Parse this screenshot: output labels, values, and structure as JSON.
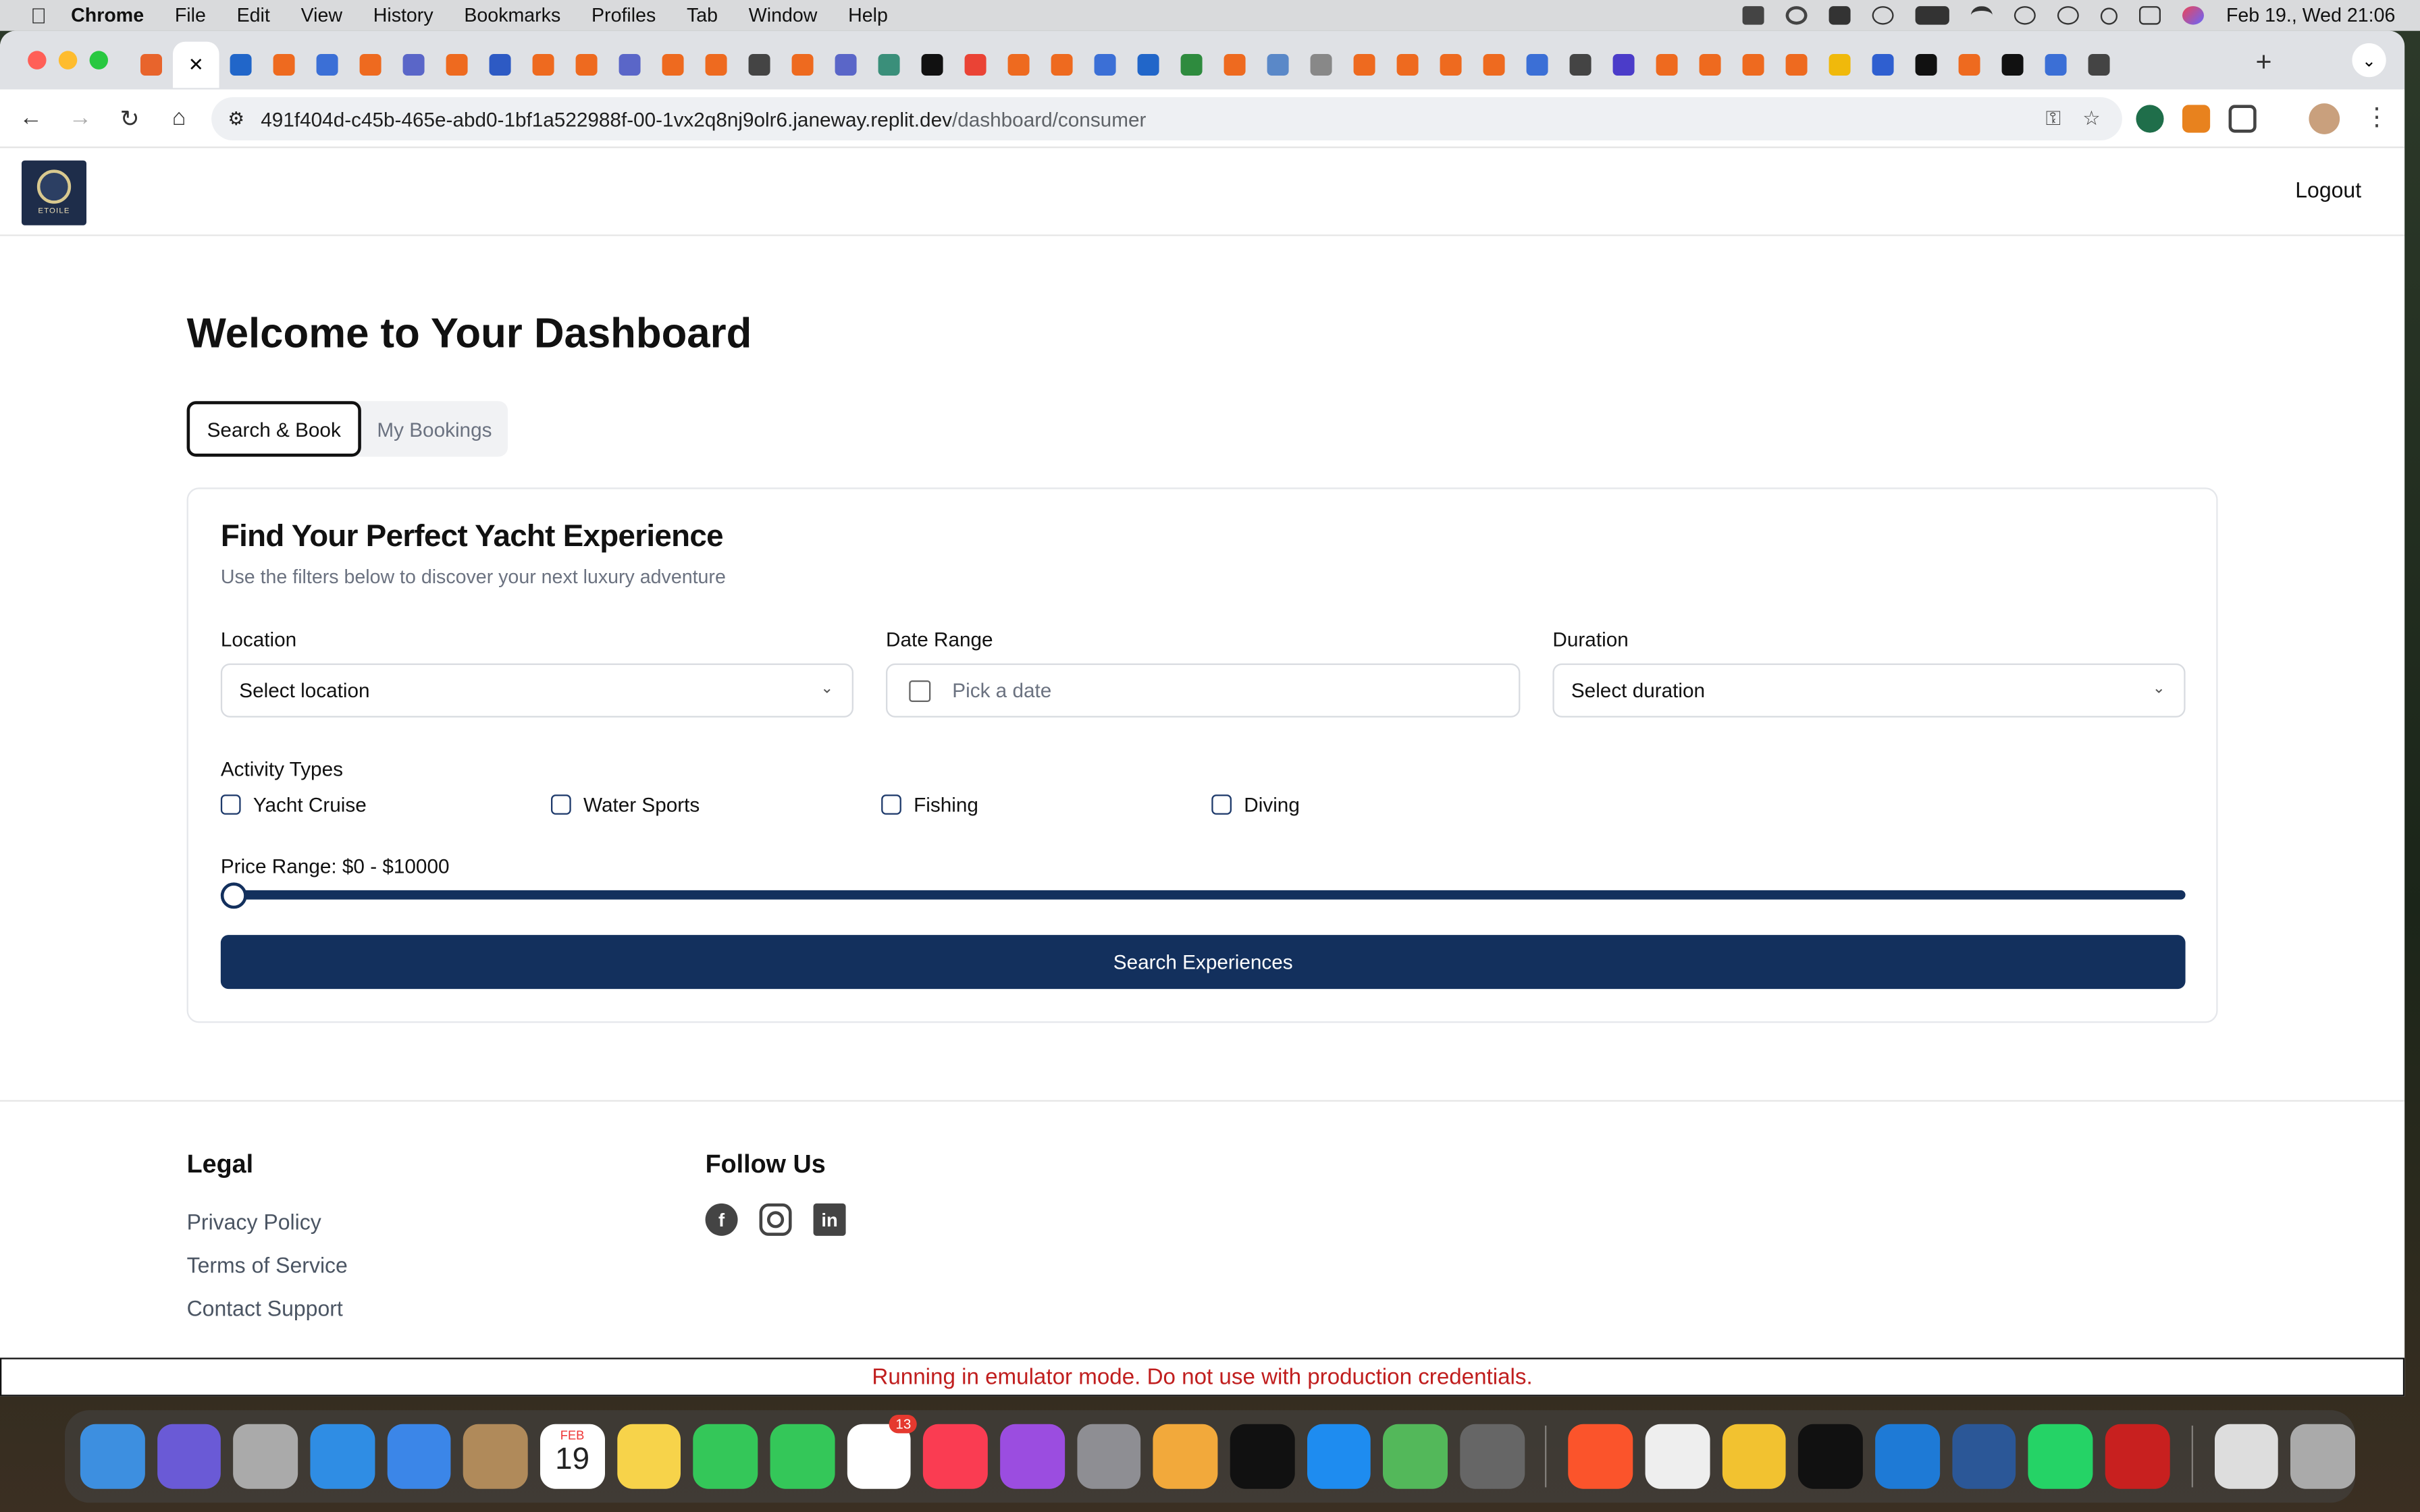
{
  "menubar": {
    "app": "Chrome",
    "items": [
      "File",
      "Edit",
      "View",
      "History",
      "Bookmarks",
      "Profiles",
      "Tab",
      "Window",
      "Help"
    ],
    "clock": "Feb 19., Wed  21:06"
  },
  "browser": {
    "url_host": "491f404d-c45b-465e-abd0-1bf1a522988f-00-1vx2q8nj9olr6.janeway.replit.dev",
    "url_path": "/dashboard/consumer",
    "new_tab": "+"
  },
  "header": {
    "logo_text": "ETOILE",
    "logout_label": "Logout"
  },
  "dashboard": {
    "title": "Welcome to Your Dashboard",
    "tabs": [
      {
        "label": "Search & Book",
        "active": true
      },
      {
        "label": "My Bookings",
        "active": false
      }
    ]
  },
  "search_card": {
    "title": "Find Your Perfect Yacht Experience",
    "subtitle": "Use the filters below to discover your next luxury adventure",
    "location": {
      "label": "Location",
      "value": "Select location"
    },
    "date_range": {
      "label": "Date Range",
      "placeholder": "Pick a date"
    },
    "duration": {
      "label": "Duration",
      "value": "Select duration"
    },
    "activity_label": "Activity Types",
    "activities": [
      {
        "label": "Yacht Cruise",
        "checked": false
      },
      {
        "label": "Water Sports",
        "checked": false
      },
      {
        "label": "Fishing",
        "checked": false
      },
      {
        "label": "Diving",
        "checked": false
      }
    ],
    "price_label": "Price Range: $0 - $10000",
    "price_min": 0,
    "price_max": 10000,
    "search_button": "Search Experiences"
  },
  "footer": {
    "legal_heading": "Legal",
    "legal_links": [
      "Privacy Policy",
      "Terms of Service",
      "Contact Support"
    ],
    "follow_heading": "Follow Us",
    "socials": [
      "facebook-icon",
      "instagram-icon",
      "linkedin-icon"
    ]
  },
  "emulator_banner": "Running in emulator mode. Do not use with production credentials.",
  "dock": {
    "reminders_badge": "13",
    "calendar_month": "FEB",
    "calendar_day": "19"
  },
  "colors": {
    "primary": "#13305d",
    "warning_text": "#c01e1e"
  }
}
